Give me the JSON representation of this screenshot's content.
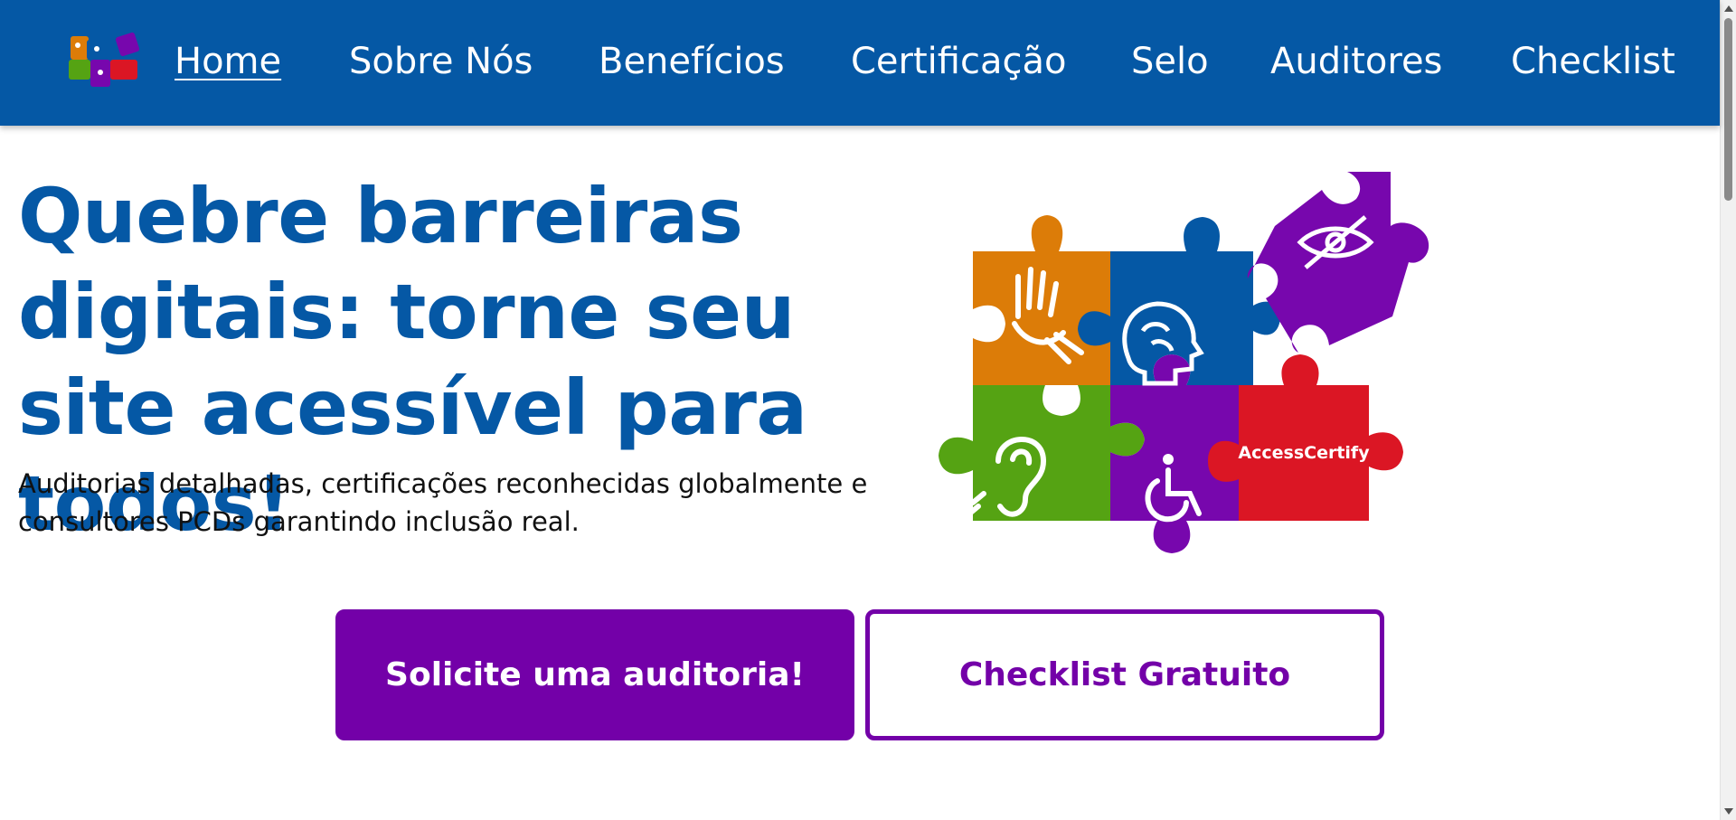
{
  "nav": {
    "items": [
      {
        "label": "Home",
        "active": true
      },
      {
        "label": "Sobre Nós"
      },
      {
        "label": "Benefícios"
      },
      {
        "label": "Certificação"
      },
      {
        "label": "Selo"
      },
      {
        "label": "Auditores"
      },
      {
        "label": "Checklist"
      }
    ],
    "logo_icon": "puzzle-logo-icon"
  },
  "hero": {
    "title": "Quebre barreiras digitais: torne seu site acessível para todos!",
    "subtitle": "Auditorias detalhadas, certificações reconhecidas globalmente e consultores PCDs garantindo inclusão real.",
    "puzzle_brand": "AccessCertify",
    "puzzle_icons": [
      "sign-language-icon",
      "brain-icon",
      "eye-slash-icon",
      "ear-icon",
      "wheelchair-icon"
    ]
  },
  "buttons": {
    "primary_label": "Solicite uma auditoria!",
    "secondary_label": "Checklist Gratuito"
  },
  "colors": {
    "nav_bg": "#0558a5",
    "title": "#0558a5",
    "purple": "#7300a8",
    "orange": "#dc7c08",
    "blue": "#0558a5",
    "violet": "#7707ad",
    "green": "#55a313",
    "red": "#db1624"
  }
}
